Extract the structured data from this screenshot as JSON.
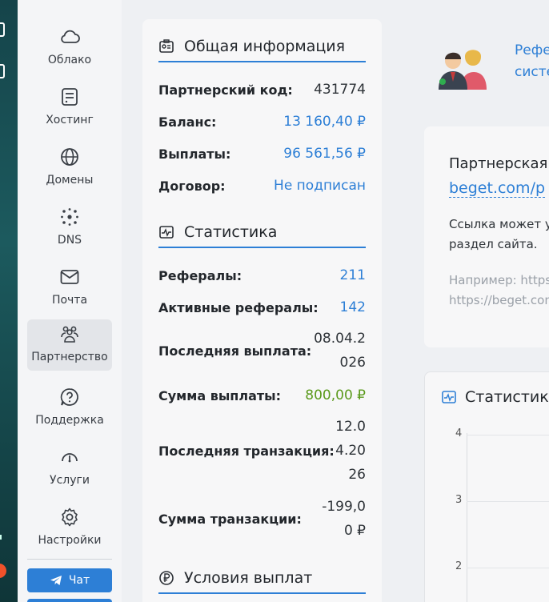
{
  "sidebar": {
    "items": [
      {
        "label": "Облако",
        "icon": "cloud-icon"
      },
      {
        "label": "Хостинг",
        "icon": "server-icon"
      },
      {
        "label": "Домены",
        "icon": "globe-icon"
      },
      {
        "label": "DNS",
        "icon": "dns-network-icon"
      },
      {
        "label": "Почта",
        "icon": "mail-icon"
      },
      {
        "label": "Партнерство",
        "icon": "partners-icon",
        "active": true
      },
      {
        "label": "Поддержка",
        "icon": "support-question-icon"
      },
      {
        "label": "Услуги",
        "icon": "services-gauge-icon"
      },
      {
        "label": "Настройки",
        "icon": "gear-icon"
      }
    ],
    "chat_label": "Чат"
  },
  "general": {
    "title": "Общая информация",
    "rows": [
      {
        "key": "Партнерский код:",
        "value": "431774"
      },
      {
        "key": "Баланс:",
        "value": "13 160,40 ₽"
      },
      {
        "key": "Выплаты:",
        "value": "96 561,56 ₽"
      },
      {
        "key": "Договор:",
        "value": "Не подписан"
      }
    ]
  },
  "stats": {
    "title": "Статистика",
    "rows": [
      {
        "key": "Рефералы:",
        "value": "211"
      },
      {
        "key": "Активные рефералы:",
        "value": "142"
      },
      {
        "key": "Последняя выплата:",
        "value_lines": [
          "08.04.2",
          "026"
        ]
      },
      {
        "key": "Сумма выплаты:",
        "value": "800,00 ₽"
      },
      {
        "key": "Последняя транзакция:",
        "value_lines": [
          "12.0",
          "4.20",
          "26"
        ]
      },
      {
        "key": "Сумма транзакции:",
        "value_lines": [
          "-199,0",
          "0 ₽"
        ]
      }
    ]
  },
  "payout_conditions": {
    "title": "Условия выплат"
  },
  "referral": {
    "link_lines": [
      "Рефе",
      "систе"
    ]
  },
  "partner_link_card": {
    "title": "Партнерская",
    "link": "beget.com/p",
    "text_lines": [
      "Ссылка может ук",
      "раздел сайта."
    ],
    "example_lines": [
      "Например: https",
      "https://beget.con"
    ]
  },
  "stat_chart": {
    "title": "Статистика",
    "y_ticks": [
      "4",
      "3",
      "2"
    ]
  },
  "colors": {
    "accent": "#2d7fd6",
    "green": "#5b9a1c",
    "alert": "#f0512a"
  }
}
